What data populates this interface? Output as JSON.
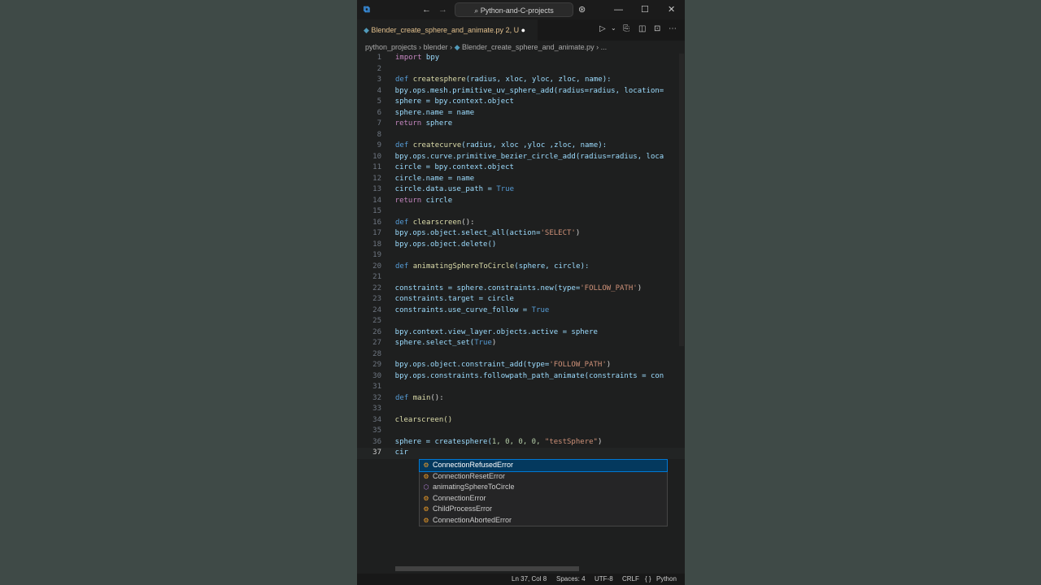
{
  "titlebar": {
    "nav_back": "←",
    "nav_forward": "→",
    "search_label": "Python-and-C-projects",
    "minimize": "—",
    "maximize": "☐",
    "close": "✕"
  },
  "tab": {
    "filename": "Blender_create_sphere_and_animate.py",
    "status": "2, U"
  },
  "breadcrumb": {
    "seg1": "python_projects",
    "seg2": "blender",
    "seg3": "Blender_create_sphere_and_animate.py",
    "seg4": "..."
  },
  "code": {
    "numbers": [
      "1",
      "2",
      "3",
      "4",
      "5",
      "6",
      "7",
      "8",
      "9",
      "10",
      "11",
      "12",
      "13",
      "14",
      "15",
      "16",
      "17",
      "18",
      "19",
      "20",
      "21",
      "22",
      "23",
      "24",
      "25",
      "26",
      "27",
      "28",
      "29",
      "30",
      "31",
      "32",
      "33",
      "34",
      "35",
      "36",
      "37"
    ],
    "l1_kw": "import",
    "l1_mod": " bpy",
    "l3_def": "def ",
    "l3_fn": "createsphere",
    "l3_rest": "(radius, xloc, yloc, zloc, name):",
    "l4": "    bpy.ops.mesh.primitive_uv_sphere_add(radius=radius, location=",
    "l5": "    sphere = bpy.context.object",
    "l6": "    sphere.name = name",
    "l7_kw": "    return",
    "l7_rest": " sphere",
    "l9_def": "def ",
    "l9_fn": "createcurve",
    "l9_rest": "(radius, xloc ,yloc ,zloc, name):",
    "l10": "    bpy.ops.curve.primitive_bezier_circle_add(radius=radius, loca",
    "l11": "    circle = bpy.context.object",
    "l12": "    circle.name = name",
    "l13_a": "    circle.data.use_path = ",
    "l13_b": "True",
    "l14_kw": "    return",
    "l14_rest": " circle",
    "l16_def": "def ",
    "l16_fn": "clearscreen",
    "l16_rest": "():",
    "l17_a": "    bpy.ops.object.select_all(action=",
    "l17_b": "'SELECT'",
    "l17_c": ")",
    "l18": "    bpy.ops.object.delete()",
    "l20_def": "def ",
    "l20_fn": "animatingSphereToCircle",
    "l20_rest": "(sphere, circle):",
    "l22_a": "    constraints = sphere.constraints.new(type=",
    "l22_b": "'FOLLOW_PATH'",
    "l22_c": ")",
    "l23": "    constraints.target = circle",
    "l24_a": "    constraints.use_curve_follow = ",
    "l24_b": "True",
    "l26": "    bpy.context.view_layer.objects.active = sphere",
    "l27_a": "    sphere.select_set(",
    "l27_b": "True",
    "l27_c": ")",
    "l29_a": "    bpy.ops.object.constraint_add(type=",
    "l29_b": "'FOLLOW_PATH'",
    "l29_c": ")",
    "l30": "    bpy.ops.constraints.followpath_path_animate(constraints = con",
    "l32_def": "def ",
    "l32_fn": "main",
    "l32_rest": "():",
    "l34": "    clearscreen()",
    "l36_a": "    sphere = createsphere(",
    "l36_b": "1, 0, 0, 0, ",
    "l36_c": "\"testSphere\"",
    "l36_d": ")",
    "l37": "    cir"
  },
  "suggestions": [
    {
      "label": "ConnectionRefusedError",
      "icon": "class-icon"
    },
    {
      "label": "ConnectionResetError",
      "icon": "class-icon"
    },
    {
      "label": "animatingSphereToCircle",
      "icon": "function-icon"
    },
    {
      "label": "ConnectionError",
      "icon": "class-icon"
    },
    {
      "label": "ChildProcessError",
      "icon": "class-icon"
    },
    {
      "label": "ConnectionAbortedError",
      "icon": "class-icon"
    }
  ],
  "status": {
    "position": "Ln 37, Col 8",
    "spaces": "Spaces: 4",
    "encoding": "UTF-8",
    "eol": "CRLF",
    "braces": "{ }",
    "language": "Python"
  },
  "colors": {
    "background": "#3f4a47",
    "editor": "#1e1f1f",
    "selection": "#04395e"
  }
}
